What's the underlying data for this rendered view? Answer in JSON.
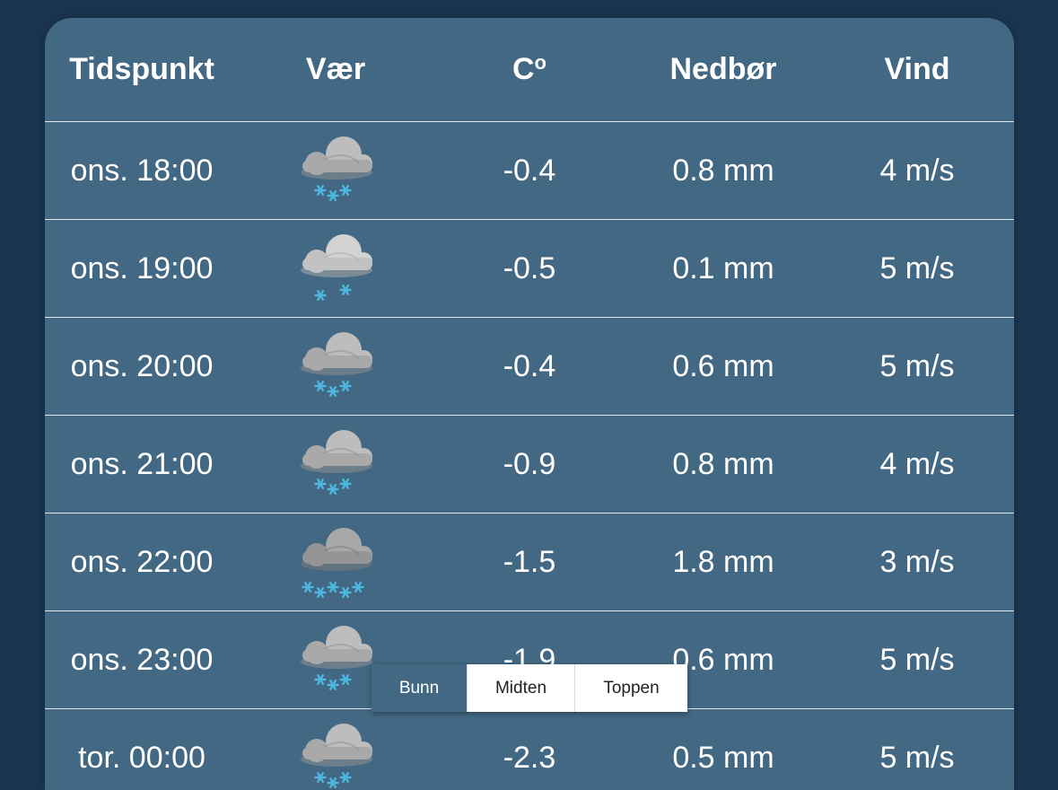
{
  "colors": {
    "background": "#1b3550",
    "panel": "#426883",
    "snow": "#4fb8e0",
    "cloud_light": "#c9c9c9",
    "cloud_dark": "#9a9a9a"
  },
  "header": {
    "col_time": "Tidspunkt",
    "col_weather": "Vær",
    "col_temp": "C",
    "col_temp_degree": "o",
    "col_precip": "Nedbør",
    "col_wind": "Vind"
  },
  "rows": [
    {
      "time": "ons. 18:00",
      "icon": "cloud-snow-icon",
      "snowflakes": 3,
      "cloud_shade": "medium",
      "temp": "-0.4",
      "precip": "0.8 mm",
      "wind": "4 m/s"
    },
    {
      "time": "ons. 19:00",
      "icon": "cloud-light-snow-icon",
      "snowflakes": 2,
      "cloud_shade": "light",
      "temp": "-0.5",
      "precip": "0.1 mm",
      "wind": "5 m/s"
    },
    {
      "time": "ons. 20:00",
      "icon": "cloud-snow-icon",
      "snowflakes": 3,
      "cloud_shade": "medium",
      "temp": "-0.4",
      "precip": "0.6 mm",
      "wind": "5 m/s"
    },
    {
      "time": "ons. 21:00",
      "icon": "cloud-snow-icon",
      "snowflakes": 3,
      "cloud_shade": "medium",
      "temp": "-0.9",
      "precip": "0.8 mm",
      "wind": "4 m/s"
    },
    {
      "time": "ons. 22:00",
      "icon": "cloud-heavy-snow-icon",
      "snowflakes": 5,
      "cloud_shade": "dark",
      "temp": "-1.5",
      "precip": "1.8 mm",
      "wind": "3 m/s"
    },
    {
      "time": "ons. 23:00",
      "icon": "cloud-snow-icon",
      "snowflakes": 3,
      "cloud_shade": "medium",
      "temp": "-1.9",
      "precip": "0.6 mm",
      "wind": "5 m/s"
    },
    {
      "time": "tor. 00:00",
      "icon": "cloud-snow-icon",
      "snowflakes": 3,
      "cloud_shade": "medium",
      "temp": "-2.3",
      "precip": "0.5 mm",
      "wind": "5 m/s"
    }
  ],
  "scroll_toggle": {
    "bottom_label": "Bunn",
    "middle_label": "Midten",
    "top_label": "Toppen",
    "active": "Bunn"
  }
}
